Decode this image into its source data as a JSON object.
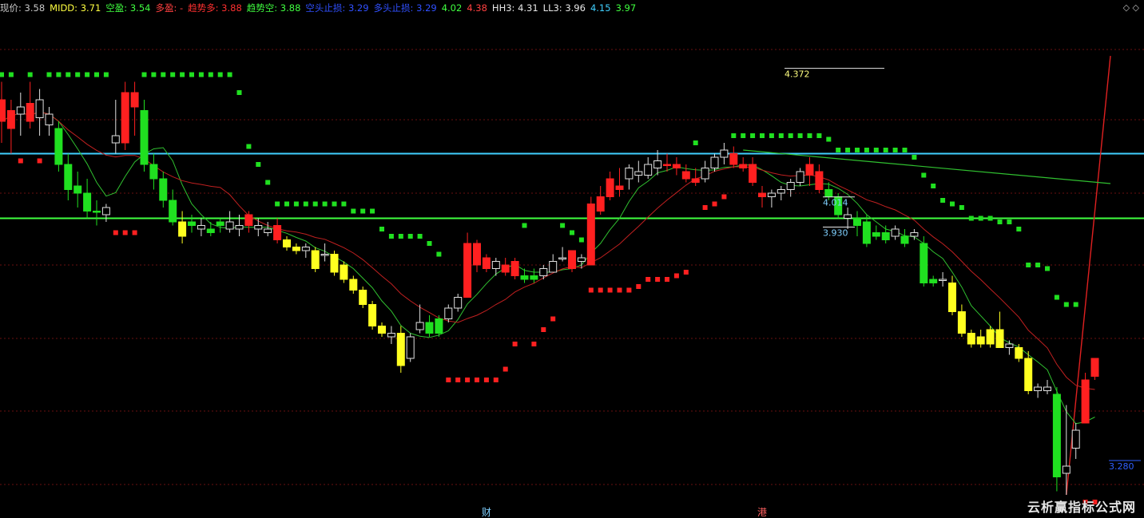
{
  "header": {
    "corner_glyph": "◇ ◇",
    "items": [
      {
        "label": "现价",
        "value": "3.58",
        "color": "#c8c8c8"
      },
      {
        "label": "MIDD",
        "value": "3.71",
        "color": "#ffff40"
      },
      {
        "label": "空盈",
        "value": "3.54",
        "color": "#40ff40"
      },
      {
        "label": "多盈",
        "value": "-",
        "color": "#ff4040"
      },
      {
        "label": "趋势多",
        "value": "3.88",
        "color": "#ff3030"
      },
      {
        "label": "趋势空",
        "value": "3.88",
        "color": "#40ff40"
      },
      {
        "label": "空头止损",
        "value": "3.29",
        "color": "#3050ff"
      },
      {
        "label": "多头止损",
        "value": "3.29",
        "color": "#3050ff"
      },
      {
        "label": "",
        "value": "4.02",
        "color": "#40ff40"
      },
      {
        "label": "",
        "value": "4.38",
        "color": "#ff4040"
      },
      {
        "label": "HH3",
        "value": "4.31",
        "color": "#e8e8e8"
      },
      {
        "label": "LL3",
        "value": "3.96",
        "color": "#e8e8e8"
      },
      {
        "label": "",
        "value": "4.15",
        "color": "#40d0ff"
      },
      {
        "label": "",
        "value": "3.97",
        "color": "#40ff40"
      }
    ]
  },
  "level_labels": [
    {
      "text": "4.372",
      "price": 4.372,
      "color": "#ffff80"
    },
    {
      "text": "4.014",
      "price": 4.014,
      "color": "#7fd0ff"
    },
    {
      "text": "3.930",
      "price": 3.93,
      "color": "#7fd0ff"
    },
    {
      "text": "3.280",
      "price": 3.28,
      "color": "#3060ff"
    }
  ],
  "bottom_markers": [
    {
      "text": "财",
      "color": "#7fd0ff",
      "bar": 51
    },
    {
      "text": "港",
      "color": "#ff6060",
      "bar": 80
    }
  ],
  "watermark": "云析赢指标公式网",
  "chart_data": {
    "type": "candlestick",
    "price_scale": {
      "top": 4.44,
      "bottom": 3.2
    },
    "horizontal_lines": [
      {
        "price": 4.15,
        "color": "#40d0ff"
      },
      {
        "price": 3.97,
        "color": "#40ff40"
      }
    ],
    "grid": true,
    "colors": {
      "up": "#ff2020",
      "down": "#20e020",
      "weak_down": "#ffff20",
      "hollow": "#e0e0e0"
    },
    "candles": [
      {
        "o": 4.3,
        "h": 4.35,
        "l": 4.18,
        "c": 4.24,
        "k": "up"
      },
      {
        "o": 4.22,
        "h": 4.3,
        "l": 4.15,
        "c": 4.27,
        "k": "up"
      },
      {
        "o": 4.26,
        "h": 4.32,
        "l": 4.2,
        "c": 4.28,
        "k": "hollow"
      },
      {
        "o": 4.29,
        "h": 4.35,
        "l": 4.22,
        "c": 4.24,
        "k": "up"
      },
      {
        "o": 4.25,
        "h": 4.33,
        "l": 4.2,
        "c": 4.3,
        "k": "hollow"
      },
      {
        "o": 4.26,
        "h": 4.28,
        "l": 4.2,
        "c": 4.23,
        "k": "hollow"
      },
      {
        "o": 4.22,
        "h": 4.24,
        "l": 4.1,
        "c": 4.12,
        "k": "down"
      },
      {
        "o": 4.12,
        "h": 4.15,
        "l": 4.02,
        "c": 4.05,
        "k": "down"
      },
      {
        "o": 4.06,
        "h": 4.1,
        "l": 4.0,
        "c": 4.04,
        "k": "down"
      },
      {
        "o": 4.04,
        "h": 4.08,
        "l": 3.97,
        "c": 3.99,
        "k": "down"
      },
      {
        "o": 3.99,
        "h": 4.02,
        "l": 3.95,
        "c": 3.99,
        "k": "down"
      },
      {
        "o": 3.98,
        "h": 4.01,
        "l": 3.96,
        "c": 4.0,
        "k": "hollow"
      },
      {
        "o": 4.2,
        "h": 4.3,
        "l": 4.15,
        "c": 4.18,
        "k": "hollow"
      },
      {
        "o": 4.18,
        "h": 4.35,
        "l": 4.16,
        "c": 4.32,
        "k": "up"
      },
      {
        "o": 4.32,
        "h": 4.35,
        "l": 4.2,
        "c": 4.28,
        "k": "up"
      },
      {
        "o": 4.27,
        "h": 4.3,
        "l": 4.1,
        "c": 4.12,
        "k": "down"
      },
      {
        "o": 4.12,
        "h": 4.15,
        "l": 4.05,
        "c": 4.08,
        "k": "down"
      },
      {
        "o": 4.08,
        "h": 4.1,
        "l": 4.0,
        "c": 4.02,
        "k": "down"
      },
      {
        "o": 4.02,
        "h": 4.05,
        "l": 3.95,
        "c": 3.96,
        "k": "down"
      },
      {
        "o": 3.96,
        "h": 3.99,
        "l": 3.9,
        "c": 3.92,
        "k": "weak_down"
      },
      {
        "o": 3.95,
        "h": 3.98,
        "l": 3.93,
        "c": 3.96,
        "k": "down"
      },
      {
        "o": 3.95,
        "h": 3.97,
        "l": 3.92,
        "c": 3.94,
        "k": "hollow"
      },
      {
        "o": 3.94,
        "h": 3.96,
        "l": 3.92,
        "c": 3.93,
        "k": "down"
      },
      {
        "o": 3.95,
        "h": 3.97,
        "l": 3.93,
        "c": 3.96,
        "k": "down"
      },
      {
        "o": 3.96,
        "h": 3.99,
        "l": 3.93,
        "c": 3.94,
        "k": "hollow"
      },
      {
        "o": 3.94,
        "h": 3.98,
        "l": 3.92,
        "c": 3.95,
        "k": "hollow"
      },
      {
        "o": 3.98,
        "h": 3.99,
        "l": 3.93,
        "c": 3.95,
        "k": "up"
      },
      {
        "o": 3.95,
        "h": 3.97,
        "l": 3.92,
        "c": 3.94,
        "k": "hollow"
      },
      {
        "o": 3.94,
        "h": 3.96,
        "l": 3.92,
        "c": 3.93,
        "k": "hollow"
      },
      {
        "o": 3.95,
        "h": 3.97,
        "l": 3.9,
        "c": 3.91,
        "k": "up"
      },
      {
        "o": 3.91,
        "h": 3.92,
        "l": 3.88,
        "c": 3.89,
        "k": "weak_down"
      },
      {
        "o": 3.89,
        "h": 3.9,
        "l": 3.87,
        "c": 3.88,
        "k": "weak_down"
      },
      {
        "o": 3.88,
        "h": 3.9,
        "l": 3.86,
        "c": 3.89,
        "k": "hollow"
      },
      {
        "o": 3.88,
        "h": 3.89,
        "l": 3.82,
        "c": 3.83,
        "k": "weak_down"
      },
      {
        "o": 3.87,
        "h": 3.9,
        "l": 3.85,
        "c": 3.87,
        "k": "hollow"
      },
      {
        "o": 3.87,
        "h": 3.88,
        "l": 3.81,
        "c": 3.82,
        "k": "weak_down"
      },
      {
        "o": 3.84,
        "h": 3.85,
        "l": 3.79,
        "c": 3.8,
        "k": "weak_down"
      },
      {
        "o": 3.8,
        "h": 3.81,
        "l": 3.76,
        "c": 3.77,
        "k": "weak_down"
      },
      {
        "o": 3.77,
        "h": 3.78,
        "l": 3.72,
        "c": 3.73,
        "k": "weak_down"
      },
      {
        "o": 3.73,
        "h": 3.74,
        "l": 3.66,
        "c": 3.67,
        "k": "weak_down"
      },
      {
        "o": 3.67,
        "h": 3.68,
        "l": 3.64,
        "c": 3.65,
        "k": "weak_down"
      },
      {
        "o": 3.64,
        "h": 3.67,
        "l": 3.62,
        "c": 3.65,
        "k": "hollow"
      },
      {
        "o": 3.65,
        "h": 3.67,
        "l": 3.54,
        "c": 3.56,
        "k": "weak_down"
      },
      {
        "o": 3.58,
        "h": 3.65,
        "l": 3.57,
        "c": 3.64,
        "k": "hollow"
      },
      {
        "o": 3.66,
        "h": 3.73,
        "l": 3.65,
        "c": 3.68,
        "k": "hollow"
      },
      {
        "o": 3.68,
        "h": 3.7,
        "l": 3.64,
        "c": 3.65,
        "k": "down"
      },
      {
        "o": 3.65,
        "h": 3.7,
        "l": 3.64,
        "c": 3.69,
        "k": "down"
      },
      {
        "o": 3.69,
        "h": 3.73,
        "l": 3.68,
        "c": 3.72,
        "k": "hollow"
      },
      {
        "o": 3.72,
        "h": 3.76,
        "l": 3.71,
        "c": 3.75,
        "k": "hollow"
      },
      {
        "o": 3.75,
        "h": 3.93,
        "l": 3.75,
        "c": 3.9,
        "k": "up"
      },
      {
        "o": 3.9,
        "h": 3.91,
        "l": 3.82,
        "c": 3.84,
        "k": "up"
      },
      {
        "o": 3.86,
        "h": 3.87,
        "l": 3.82,
        "c": 3.83,
        "k": "up"
      },
      {
        "o": 3.83,
        "h": 3.86,
        "l": 3.81,
        "c": 3.85,
        "k": "hollow"
      },
      {
        "o": 3.84,
        "h": 3.86,
        "l": 3.81,
        "c": 3.82,
        "k": "up"
      },
      {
        "o": 3.85,
        "h": 3.86,
        "l": 3.8,
        "c": 3.81,
        "k": "up"
      },
      {
        "o": 3.81,
        "h": 3.83,
        "l": 3.79,
        "c": 3.8,
        "k": "down"
      },
      {
        "o": 3.8,
        "h": 3.83,
        "l": 3.79,
        "c": 3.81,
        "k": "down"
      },
      {
        "o": 3.81,
        "h": 3.84,
        "l": 3.8,
        "c": 3.83,
        "k": "hollow"
      },
      {
        "o": 3.82,
        "h": 3.87,
        "l": 3.82,
        "c": 3.85,
        "k": "hollow"
      },
      {
        "o": 3.86,
        "h": 3.89,
        "l": 3.85,
        "c": 3.86,
        "k": "hollow"
      },
      {
        "o": 3.88,
        "h": 3.88,
        "l": 3.82,
        "c": 3.83,
        "k": "up"
      },
      {
        "o": 3.85,
        "h": 3.87,
        "l": 3.83,
        "c": 3.86,
        "k": "hollow"
      },
      {
        "o": 3.84,
        "h": 4.03,
        "l": 3.84,
        "c": 4.01,
        "k": "up"
      },
      {
        "o": 4.03,
        "h": 4.06,
        "l": 3.98,
        "c": 3.99,
        "k": "up"
      },
      {
        "o": 4.03,
        "h": 4.1,
        "l": 4.02,
        "c": 4.08,
        "k": "up"
      },
      {
        "o": 4.06,
        "h": 4.11,
        "l": 4.03,
        "c": 4.05,
        "k": "up"
      },
      {
        "o": 4.08,
        "h": 4.12,
        "l": 4.05,
        "c": 4.11,
        "k": "hollow"
      },
      {
        "o": 4.1,
        "h": 4.13,
        "l": 4.07,
        "c": 4.09,
        "k": "hollow"
      },
      {
        "o": 4.09,
        "h": 4.14,
        "l": 4.08,
        "c": 4.12,
        "k": "hollow"
      },
      {
        "o": 4.11,
        "h": 4.16,
        "l": 4.09,
        "c": 4.13,
        "k": "hollow"
      },
      {
        "o": 4.12,
        "h": 4.15,
        "l": 4.1,
        "c": 4.12,
        "k": "up"
      },
      {
        "o": 4.12,
        "h": 4.14,
        "l": 4.09,
        "c": 4.11,
        "k": "up"
      },
      {
        "o": 4.1,
        "h": 4.12,
        "l": 4.07,
        "c": 4.08,
        "k": "up"
      },
      {
        "o": 4.08,
        "h": 4.11,
        "l": 4.06,
        "c": 4.07,
        "k": "up"
      },
      {
        "o": 4.08,
        "h": 4.13,
        "l": 4.07,
        "c": 4.11,
        "k": "hollow"
      },
      {
        "o": 4.11,
        "h": 4.15,
        "l": 4.1,
        "c": 4.14,
        "k": "hollow"
      },
      {
        "o": 4.14,
        "h": 4.18,
        "l": 4.12,
        "c": 4.16,
        "k": "hollow"
      },
      {
        "o": 4.15,
        "h": 4.17,
        "l": 4.11,
        "c": 4.12,
        "k": "up"
      },
      {
        "o": 4.12,
        "h": 4.14,
        "l": 4.1,
        "c": 4.11,
        "k": "up"
      },
      {
        "o": 4.12,
        "h": 4.14,
        "l": 4.06,
        "c": 4.07,
        "k": "up"
      },
      {
        "o": 4.04,
        "h": 4.06,
        "l": 4.0,
        "c": 4.03,
        "k": "up"
      },
      {
        "o": 4.03,
        "h": 4.05,
        "l": 4.0,
        "c": 4.04,
        "k": "hollow"
      },
      {
        "o": 4.04,
        "h": 4.06,
        "l": 4.02,
        "c": 4.05,
        "k": "hollow"
      },
      {
        "o": 4.05,
        "h": 4.08,
        "l": 4.03,
        "c": 4.07,
        "k": "hollow"
      },
      {
        "o": 4.07,
        "h": 4.11,
        "l": 4.06,
        "c": 4.1,
        "k": "hollow"
      },
      {
        "o": 4.12,
        "h": 4.14,
        "l": 4.06,
        "c": 4.09,
        "k": "up"
      },
      {
        "o": 4.1,
        "h": 4.12,
        "l": 4.04,
        "c": 4.05,
        "k": "up"
      },
      {
        "o": 4.05,
        "h": 4.07,
        "l": 4.02,
        "c": 4.03,
        "k": "down"
      },
      {
        "o": 4.03,
        "h": 4.04,
        "l": 3.97,
        "c": 3.98,
        "k": "down"
      },
      {
        "o": 3.98,
        "h": 4.0,
        "l": 3.94,
        "c": 3.97,
        "k": "hollow"
      },
      {
        "o": 3.97,
        "h": 3.99,
        "l": 3.92,
        "c": 3.95,
        "k": "down"
      },
      {
        "o": 3.96,
        "h": 3.98,
        "l": 3.89,
        "c": 3.9,
        "k": "down"
      },
      {
        "o": 3.92,
        "h": 3.95,
        "l": 3.91,
        "c": 3.93,
        "k": "down"
      },
      {
        "o": 3.93,
        "h": 3.95,
        "l": 3.9,
        "c": 3.91,
        "k": "down"
      },
      {
        "o": 3.92,
        "h": 3.95,
        "l": 3.91,
        "c": 3.94,
        "k": "hollow"
      },
      {
        "o": 3.92,
        "h": 3.94,
        "l": 3.89,
        "c": 3.9,
        "k": "down"
      },
      {
        "o": 3.92,
        "h": 3.94,
        "l": 3.91,
        "c": 3.93,
        "k": "hollow"
      },
      {
        "o": 3.9,
        "h": 3.92,
        "l": 3.78,
        "c": 3.79,
        "k": "down"
      },
      {
        "o": 3.8,
        "h": 3.81,
        "l": 3.78,
        "c": 3.79,
        "k": "down"
      },
      {
        "o": 3.8,
        "h": 3.82,
        "l": 3.78,
        "c": 3.8,
        "k": "hollow"
      },
      {
        "o": 3.79,
        "h": 3.81,
        "l": 3.7,
        "c": 3.71,
        "k": "weak_down"
      },
      {
        "o": 3.71,
        "h": 3.73,
        "l": 3.64,
        "c": 3.65,
        "k": "weak_down"
      },
      {
        "o": 3.65,
        "h": 3.66,
        "l": 3.61,
        "c": 3.62,
        "k": "weak_down"
      },
      {
        "o": 3.64,
        "h": 3.66,
        "l": 3.61,
        "c": 3.62,
        "k": "weak_down"
      },
      {
        "o": 3.66,
        "h": 3.67,
        "l": 3.61,
        "c": 3.62,
        "k": "weak_down"
      },
      {
        "o": 3.66,
        "h": 3.71,
        "l": 3.61,
        "c": 3.61,
        "k": "weak_down"
      },
      {
        "o": 3.61,
        "h": 3.63,
        "l": 3.59,
        "c": 3.62,
        "k": "hollow"
      },
      {
        "o": 3.61,
        "h": 3.62,
        "l": 3.57,
        "c": 3.58,
        "k": "weak_down"
      },
      {
        "o": 3.58,
        "h": 3.6,
        "l": 3.48,
        "c": 3.49,
        "k": "weak_down"
      },
      {
        "o": 3.49,
        "h": 3.51,
        "l": 3.47,
        "c": 3.5,
        "k": "hollow"
      },
      {
        "o": 3.5,
        "h": 3.52,
        "l": 3.48,
        "c": 3.49,
        "k": "hollow"
      },
      {
        "o": 3.48,
        "h": 3.5,
        "l": 3.21,
        "c": 3.25,
        "k": "down"
      },
      {
        "o": 3.26,
        "h": 3.45,
        "l": 3.2,
        "c": 3.28,
        "k": "hollow"
      },
      {
        "o": 3.33,
        "h": 3.4,
        "l": 3.3,
        "c": 3.38,
        "k": "hollow"
      },
      {
        "o": 3.4,
        "h": 3.54,
        "l": 3.4,
        "c": 3.52,
        "k": "up"
      },
      {
        "o": 3.53,
        "h": 3.58,
        "l": 3.52,
        "c": 3.58,
        "k": "up"
      }
    ]
  }
}
